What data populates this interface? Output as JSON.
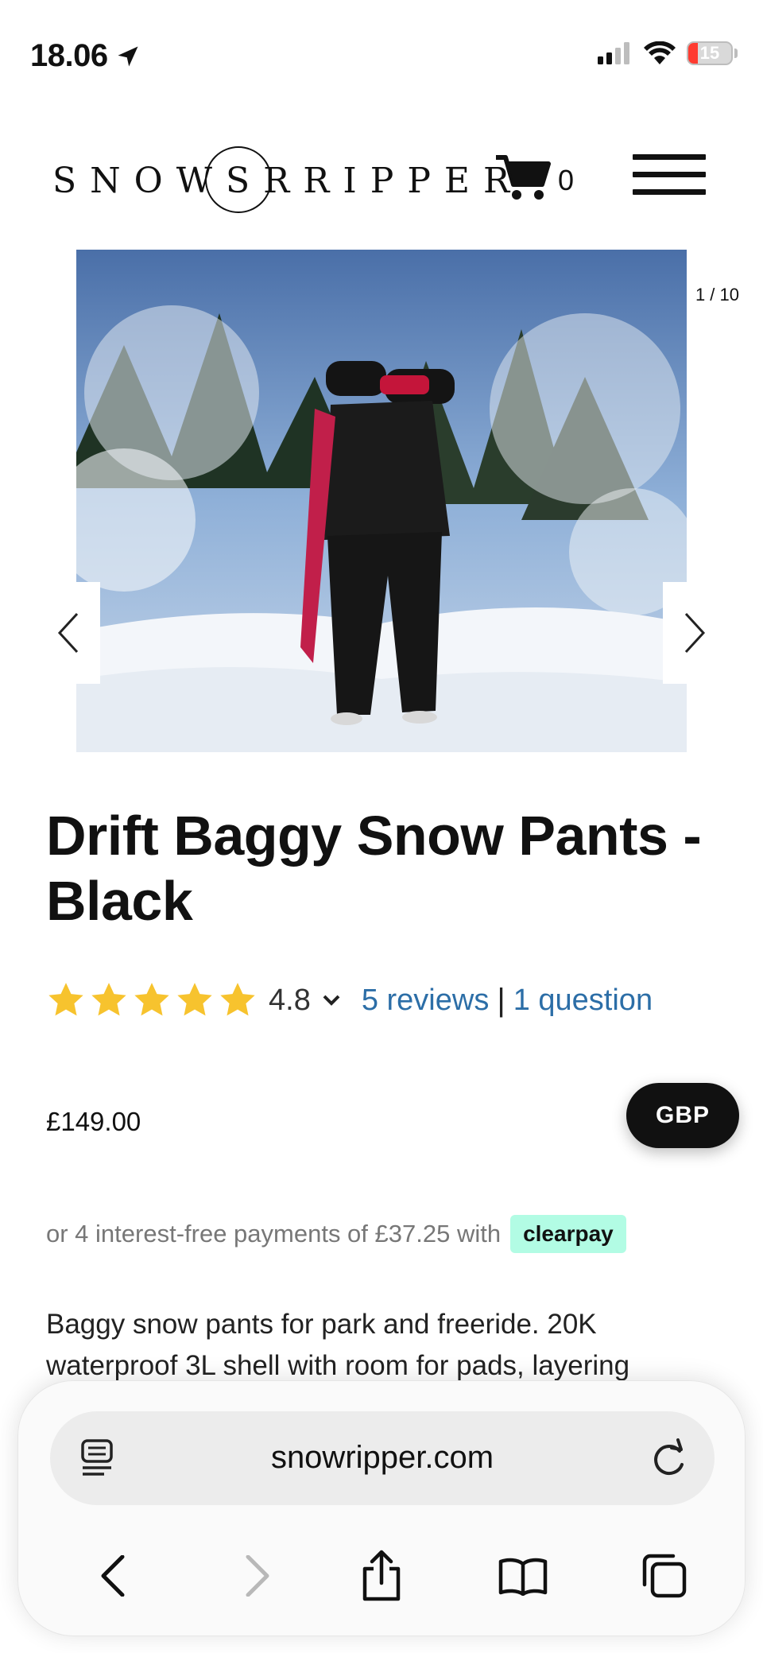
{
  "status_bar": {
    "time": "18.06",
    "battery": "15"
  },
  "header": {
    "logo_text": "SNOWSRRIPPER",
    "cart_count": "0"
  },
  "gallery": {
    "counter": "1 / 10"
  },
  "product": {
    "title": "Drift Baggy Snow Pants - Black",
    "rating": "4.8",
    "stars": 5,
    "reviews_link": "5 reviews",
    "separator": "|",
    "question_link": "1 question",
    "price": "£149.00",
    "currency": "GBP",
    "installment_text": "or 4 interest-free payments of £37.25 with",
    "installment_provider": "clearpay",
    "description": "Baggy snow pants for park and freeride. 20K waterproof 3L shell with room for pads, layering"
  },
  "browser": {
    "url": "snowripper.com"
  },
  "colors": {
    "star": "#f7c32e",
    "link": "#2c6ea7",
    "clearpay": "#b2fce4",
    "currency_button": "#111111"
  }
}
